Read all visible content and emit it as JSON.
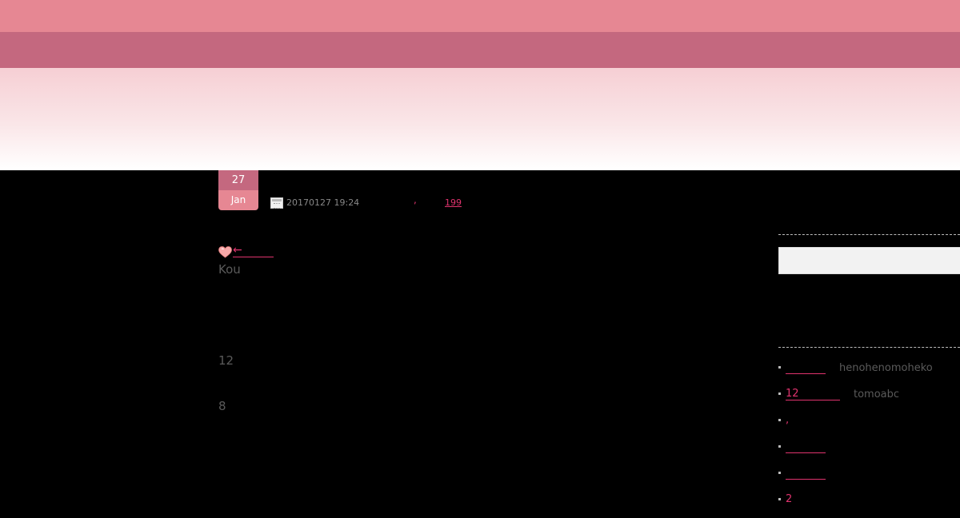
{
  "header": {
    "colors": {
      "top_band": "#e68793",
      "mid_band": "#c4687f",
      "fade_top": "#f6cfd4"
    }
  },
  "post": {
    "date_badge": {
      "day": "27",
      "month": "Jan"
    },
    "meta": {
      "datetime": "20170127 19:24",
      "separator": ",",
      "comment_count": "199"
    },
    "prev_link": {
      "icon": "heart-icon",
      "arrow": "←"
    },
    "body": {
      "line1": "Kou",
      "line2": "12",
      "line3": "8"
    }
  },
  "sidebar": {
    "search": {
      "placeholder": ""
    },
    "recent_comments": [
      {
        "link": "",
        "author": "henohenomoheko"
      },
      {
        "link": "12",
        "author": "tomoabc"
      },
      {
        "link": ",",
        "author": ""
      },
      {
        "link": "",
        "author": ""
      },
      {
        "link": "",
        "author": ""
      },
      {
        "link": "2",
        "author": ""
      }
    ]
  },
  "colors": {
    "accent": "#e0336e",
    "muted_text": "#5a5a5a",
    "background": "#000000"
  }
}
